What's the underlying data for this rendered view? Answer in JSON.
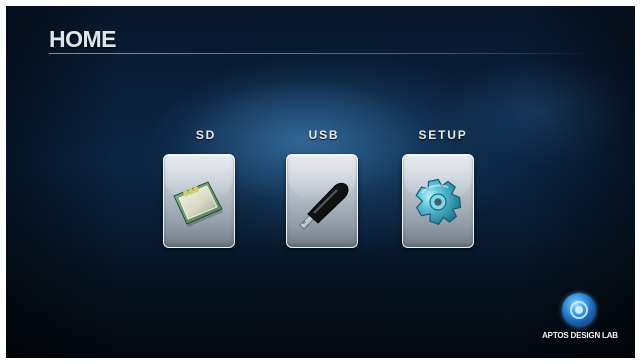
{
  "screen": {
    "title": "HOME"
  },
  "menu": {
    "items": [
      {
        "label": "SD",
        "icon": "sd-card-icon"
      },
      {
        "label": "USB",
        "icon": "usb-drive-icon"
      },
      {
        "label": "SETUP",
        "icon": "gear-icon"
      }
    ]
  },
  "brand": {
    "text": "APTOS DESIGN LAB",
    "logo": "aptos-logo"
  },
  "colors": {
    "background": "#0b2543",
    "tile": "#bcc5cf",
    "text": "#e6eaee"
  }
}
